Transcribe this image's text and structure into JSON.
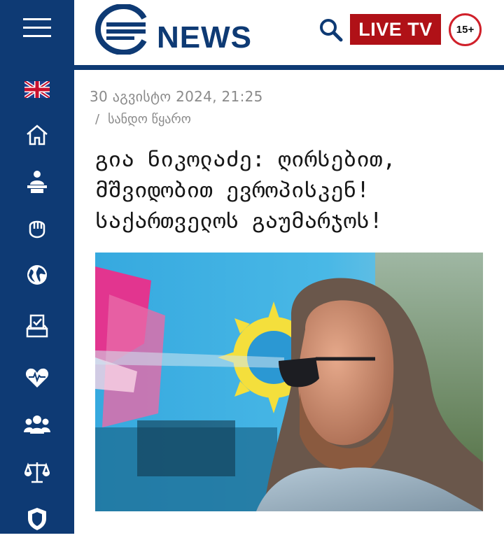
{
  "header": {
    "logo_text": "NEWS",
    "live_label": "LIVE TV",
    "age_badge": "15+",
    "brand_color": "#0e3a74",
    "live_color": "#b01117"
  },
  "sidebar": {
    "items": [
      {
        "icon": "uk-flag-icon"
      },
      {
        "icon": "home-icon"
      },
      {
        "icon": "speaker-podium-icon"
      },
      {
        "icon": "fist-icon"
      },
      {
        "icon": "globe-icon"
      },
      {
        "icon": "ballot-box-icon"
      },
      {
        "icon": "heart-pulse-icon"
      },
      {
        "icon": "people-icon"
      },
      {
        "icon": "scales-icon"
      },
      {
        "icon": "shield-icon"
      }
    ]
  },
  "article": {
    "date": "30 აგვისტო 2024, 21:25",
    "source_sep": "/",
    "source": "სანდო წყარო",
    "title_lines": [
      "გია ნიკოლაძე: ღირსებით,",
      "მშვიდობით ევროპისკენ!",
      "საქართველოს გაუმარჯოს!"
    ]
  }
}
